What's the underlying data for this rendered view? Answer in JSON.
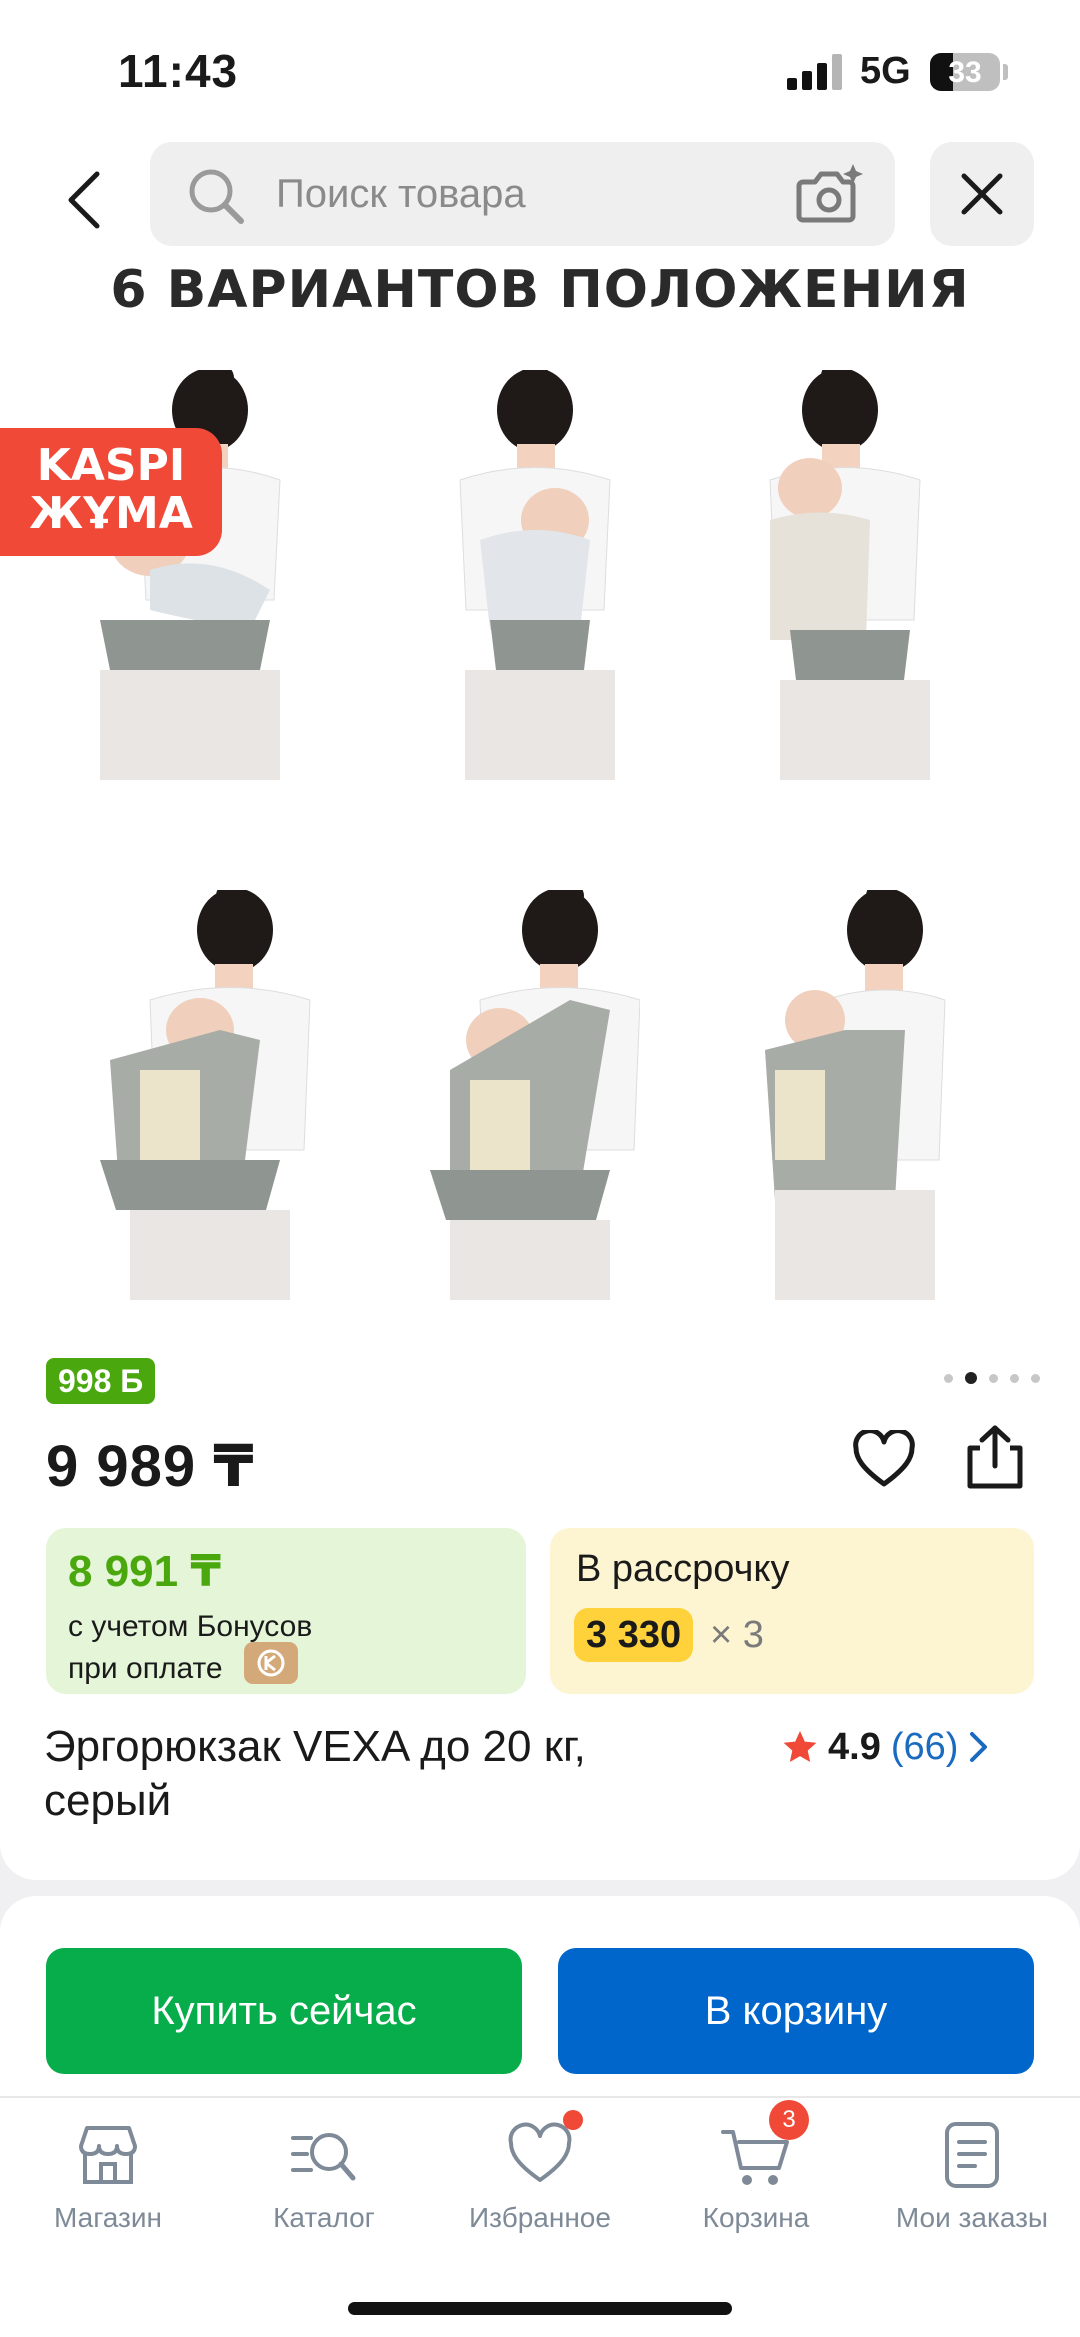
{
  "status_bar": {
    "time": "11:43",
    "network": "5G",
    "battery": "33",
    "battery_level_percent": 33
  },
  "search": {
    "placeholder": "Поиск товара",
    "back_icon": "chevron-left-icon",
    "search_icon": "search-icon",
    "camera_icon": "camera-ai-icon",
    "close_icon": "close-icon"
  },
  "gallery": {
    "title": "6 ВАРИАНТОВ ПОЛОЖЕНИЯ",
    "badge_line1": "KASPI",
    "badge_line2": "ЖҰМА",
    "slide_count": 5,
    "active_slide": 2
  },
  "product": {
    "bonus_badge": "998 Б",
    "price": "9 989 ₸",
    "bonus_price": "8 991 ₸",
    "bonus_line1": "с учетом Бонусов",
    "bonus_line2": "при оплате",
    "installment_label": "В рассрочку",
    "installment_amount": "3 330",
    "installment_multiplier": "× 3",
    "name": "Эргорюкзак VEXA до 20 кг, серый",
    "rating": "4.9",
    "reviews": "(66)",
    "colors": {
      "bonus_green": "#4aa80e",
      "rating_star": "#f04937",
      "review_link": "#1a6bbf"
    }
  },
  "actions": {
    "buy_now": "Купить сейчас",
    "add_to_cart": "В корзину",
    "colors": {
      "buy": "#07ad4a",
      "cart": "#0066cc"
    }
  },
  "bottom_nav": {
    "items": [
      {
        "label": "Магазин",
        "icon": "store-icon"
      },
      {
        "label": "Каталог",
        "icon": "catalog-search-icon"
      },
      {
        "label": "Избранное",
        "icon": "heart-icon"
      },
      {
        "label": "Корзина",
        "icon": "cart-icon",
        "badge": "3"
      },
      {
        "label": "Мои заказы",
        "icon": "orders-icon"
      }
    ]
  }
}
